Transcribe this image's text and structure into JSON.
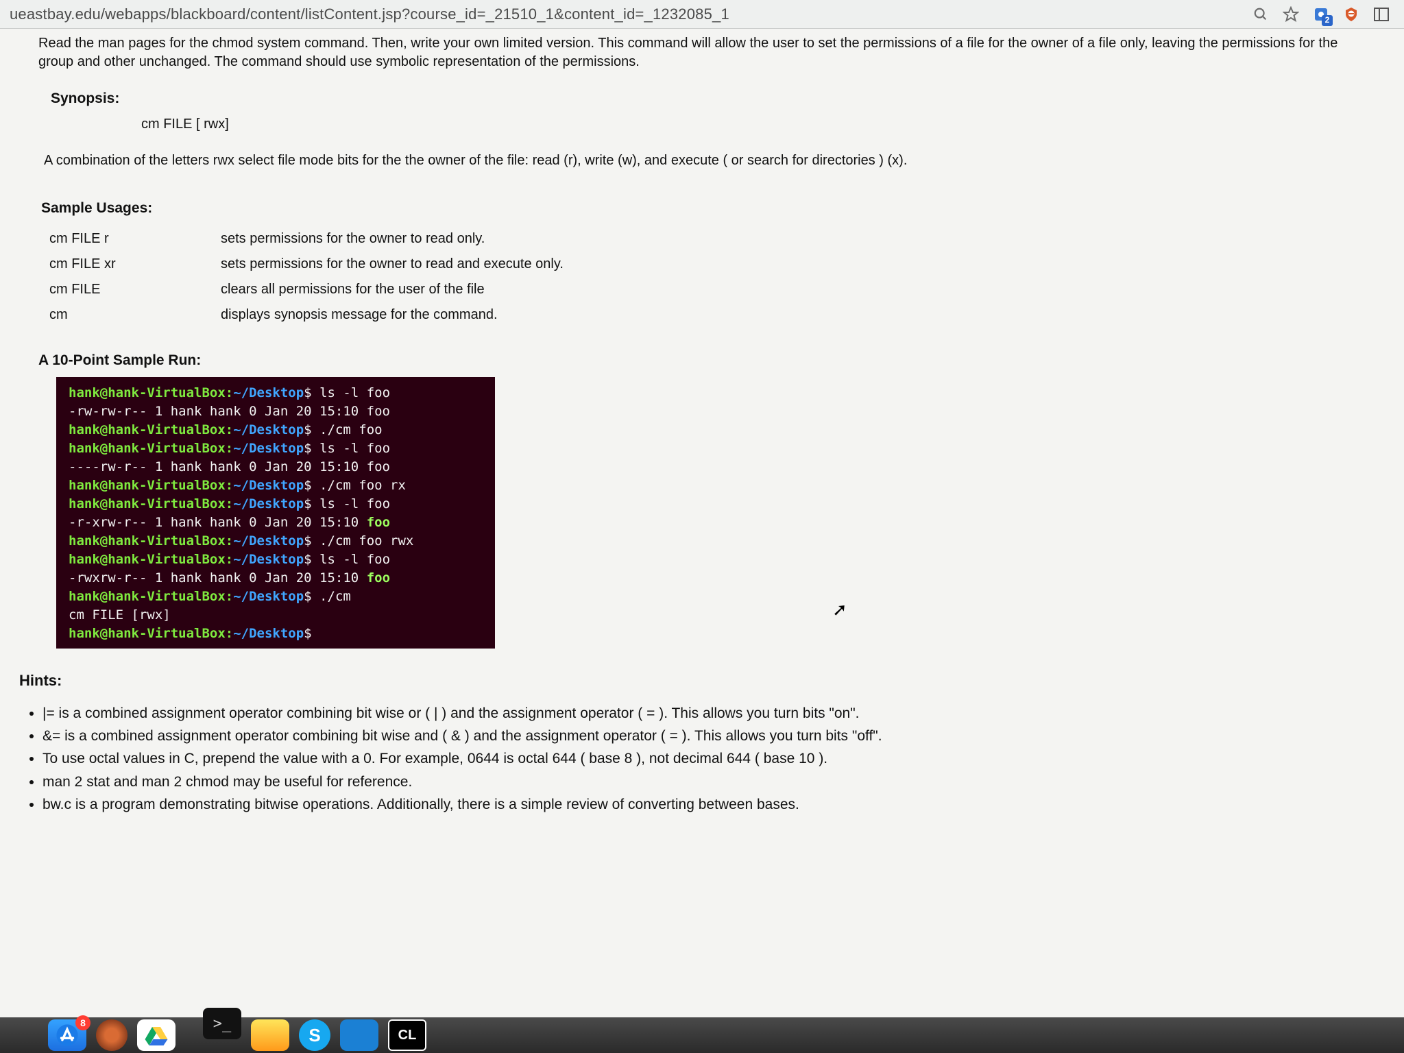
{
  "browser": {
    "url": "ueastbay.edu/webapps/blackboard/content/listContent.jsp?course_id=_21510_1&content_id=_1232085_1",
    "ext_badge": "2"
  },
  "content": {
    "intro": "Read the man pages for the chmod system command.  Then, write your own limited version. This command will allow the user to set the permissions of a file for the owner of a file only, leaving the permissions for the group and other unchanged.  The command should use symbolic representation of the permissions.",
    "synopsis_label": "Synopsis:",
    "synopsis": "cm FILE [  rwx]",
    "combo": "A combination of the letters   rwx select file mode bits for the  the owner of the file:  read (r), write (w), and execute ( or search for directories ) (x).",
    "sample_usages_label": "Sample Usages:",
    "usages": [
      {
        "cmd": "cm FILE r",
        "desc": "sets permissions for the owner to read only."
      },
      {
        "cmd": "cm FILE  xr",
        "desc": "sets permissions for the owner to read and execute only."
      },
      {
        "cmd": "cm FILE",
        "desc": "clears all permissions for the user of the file"
      },
      {
        "cmd": "cm",
        "desc": "displays synopsis message for the command."
      }
    ],
    "run_label": "A 10-Point Sample Run:",
    "terminal": {
      "prompt_user": "hank@hank-VirtualBox:",
      "prompt_path": "~/Desktop",
      "lines": [
        {
          "t": "cmd",
          "text": "ls -l foo"
        },
        {
          "t": "out",
          "text": "-rw-rw-r-- 1 hank hank 0 Jan 20 15:10 foo"
        },
        {
          "t": "cmd",
          "text": "./cm foo"
        },
        {
          "t": "cmd",
          "text": "ls -l foo"
        },
        {
          "t": "out",
          "text": "----rw-r-- 1 hank hank 0 Jan 20 15:10 foo"
        },
        {
          "t": "cmd",
          "text": "./cm foo rx"
        },
        {
          "t": "cmd",
          "text": "ls -l foo"
        },
        {
          "t": "outf",
          "text": "-r-xrw-r-- 1 hank hank 0 Jan 20 15:10 ",
          "file": "foo"
        },
        {
          "t": "cmd",
          "text": "./cm foo rwx"
        },
        {
          "t": "cmd",
          "text": "ls -l foo"
        },
        {
          "t": "outf",
          "text": "-rwxrw-r-- 1 hank hank 0 Jan 20 15:10 ",
          "file": "foo"
        },
        {
          "t": "cmd",
          "text": "./cm"
        },
        {
          "t": "out",
          "text": "cm FILE [rwx]"
        },
        {
          "t": "cmd",
          "text": ""
        }
      ]
    },
    "hints_label": "Hints:",
    "hints": [
      "|= is a combined assignment operator combining bit wise or ( | ) and the assignment operator ( = ). This allows you turn bits \"on\".",
      "&= is a combined assignment operator combining bit wise and ( & ) and the assignment operator ( = ). This allows you turn bits \"off\".",
      "To use octal values in C, prepend the value with a 0. For example, 0644 is octal 644 ( base 8 ), not decimal 644 ( base 10 ).",
      "man 2 stat and man 2 chmod may be useful for reference.",
      "bw.c is a program demonstrating bitwise operations.  Additionally, there is a simple review of converting between bases."
    ]
  },
  "dock": {
    "appstore_badge": "8"
  }
}
